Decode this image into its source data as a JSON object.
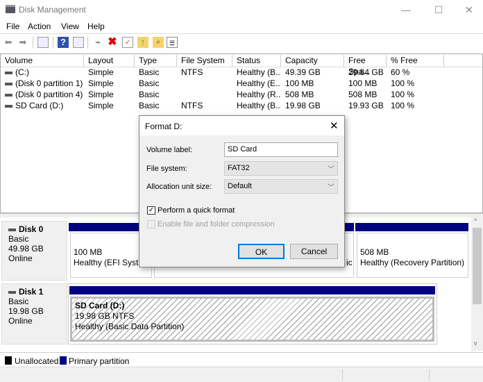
{
  "window": {
    "title": "Disk Management",
    "minimize": "—",
    "maximize": "☐",
    "close": "✕"
  },
  "menu": [
    "File",
    "Action",
    "View",
    "Help"
  ],
  "toolbar": {
    "icons": [
      "back-icon",
      "forward-icon",
      "console-tree-icon",
      "help-icon",
      "action-pane-icon",
      "connect-icon",
      "delete-icon",
      "properties-icon",
      "folder-up-icon",
      "search-folder-icon",
      "list-view-icon"
    ]
  },
  "list": {
    "columns": [
      "Volume",
      "Layout",
      "Type",
      "File System",
      "Status",
      "Capacity",
      "Free Spa...",
      "% Free"
    ],
    "rows": [
      [
        "(C:)",
        "Simple",
        "Basic",
        "NTFS",
        "Healthy (B...",
        "49.39 GB",
        "29.84 GB",
        "60 %"
      ],
      [
        "(Disk 0 partition 1)",
        "Simple",
        "Basic",
        "",
        "Healthy (E...",
        "100 MB",
        "100 MB",
        "100 %"
      ],
      [
        "(Disk 0 partition 4)",
        "Simple",
        "Basic",
        "",
        "Healthy (R...",
        "508 MB",
        "508 MB",
        "100 %"
      ],
      [
        "SD Card (D:)",
        "Simple",
        "Basic",
        "NTFS",
        "Healthy (B...",
        "19.98 GB",
        "19.93 GB",
        "100 %"
      ]
    ]
  },
  "disks": [
    {
      "name": "Disk 0",
      "type": "Basic",
      "size": "49.98 GB",
      "state": "Online",
      "partitions": [
        {
          "size": "100 MB",
          "status": "Healthy (EFI System"
        },
        {
          "status_tail": "ic"
        },
        {
          "size": "508 MB",
          "status": "Healthy (Recovery Partition)"
        }
      ]
    },
    {
      "name": "Disk 1",
      "type": "Basic",
      "size": "19.98 GB",
      "state": "Online",
      "partitions": [
        {
          "name": "SD Card  (D:)",
          "size": "19.98 GB NTFS",
          "status": "Healthy (Basic Data Partition)"
        }
      ]
    }
  ],
  "legend": [
    {
      "label": "Unallocated",
      "color": "#000000"
    },
    {
      "label": "Primary partition",
      "color": "#000080"
    }
  ],
  "dialog": {
    "title": "Format D:",
    "volume_label_label": "Volume label:",
    "volume_label_value": "SD Card",
    "file_system_label": "File system:",
    "file_system_value": "FAT32",
    "alloc_label": "Allocation unit size:",
    "alloc_value": "Default",
    "quick_format": {
      "label": "Perform a quick format",
      "checked": true
    },
    "compression": {
      "label": "Enable file and folder compression",
      "checked": false,
      "enabled": false
    },
    "ok": "OK",
    "cancel": "Cancel",
    "close": "✕"
  }
}
